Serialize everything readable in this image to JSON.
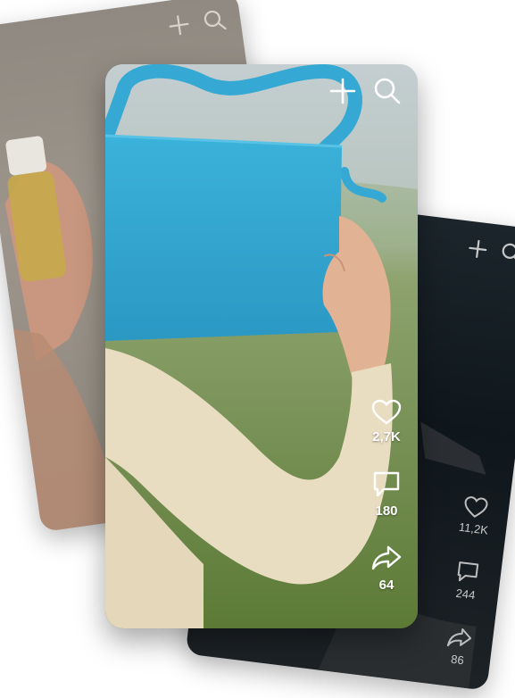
{
  "cards": {
    "left": {
      "icons": [
        "plus-icon",
        "search-icon"
      ]
    },
    "front": {
      "icons": [
        "plus-icon",
        "search-icon"
      ],
      "actions": {
        "likes": "2,7K",
        "comments": "180",
        "shares": "64"
      }
    },
    "right": {
      "icons": [
        "plus-icon",
        "search-icon"
      ],
      "actions": {
        "likes": "11,2K",
        "comments": "244",
        "shares": "86"
      }
    }
  },
  "colors": {
    "bag": "#35a9d3",
    "sleeve": "#e8dcc0",
    "skin": "#e5b79c",
    "grass": "#6d8a43"
  }
}
